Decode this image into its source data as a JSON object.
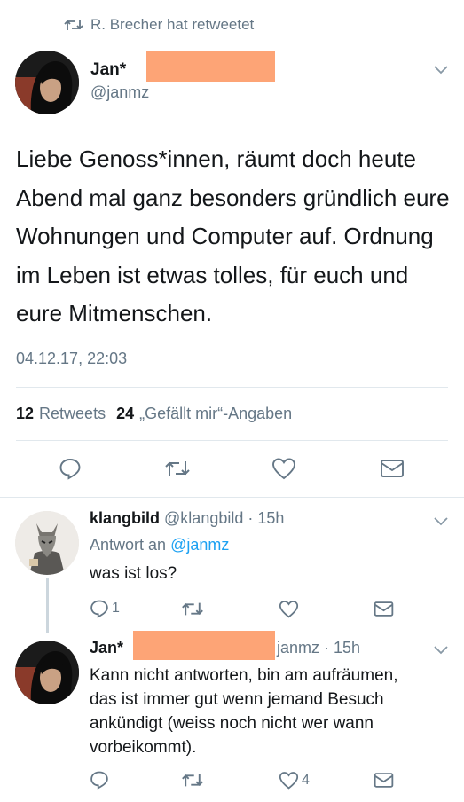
{
  "retweet_header": {
    "text": "R. Brecher hat retweetet"
  },
  "main_tweet": {
    "author_name": "Jan*",
    "handle": "@janmz",
    "text": "Liebe Genoss*innen, räumt doch heute Abend mal ganz besonders gründlich eure Wohnungen und Computer auf. Ordnung im Leben ist etwas tolles, für euch und eure Mitmenschen.",
    "timestamp": "04.12.17, 22:03",
    "retweet_count": "12",
    "retweet_label": "Retweets",
    "like_count": "24",
    "like_label": "„Gefällt mir“-Angaben"
  },
  "reply_1": {
    "author_name": "klangbild",
    "handle": "@klangbild",
    "time": "· 15h",
    "reply_prefix": "Antwort an",
    "reply_to": "@janmz",
    "text": "was ist los?",
    "reply_count": "1"
  },
  "reply_2": {
    "author_name": "Jan*",
    "handle_partial": "janmz",
    "time": "· 15h",
    "text_lines": [
      "Kann nicht antworten, bin am aufräumen,",
      "das ist immer gut wenn jemand Besuch",
      "ankündigt (weiss noch nicht wer wann",
      "vorbeikommt)."
    ],
    "like_count": "4"
  },
  "colors": {
    "accent": "#1da1f2",
    "muted": "#657786",
    "redaction": "#fda476",
    "divider": "#e1e8ed"
  },
  "icons": [
    "retweet-icon",
    "chevron-down-icon",
    "reply-icon",
    "like-icon",
    "message-icon"
  ]
}
